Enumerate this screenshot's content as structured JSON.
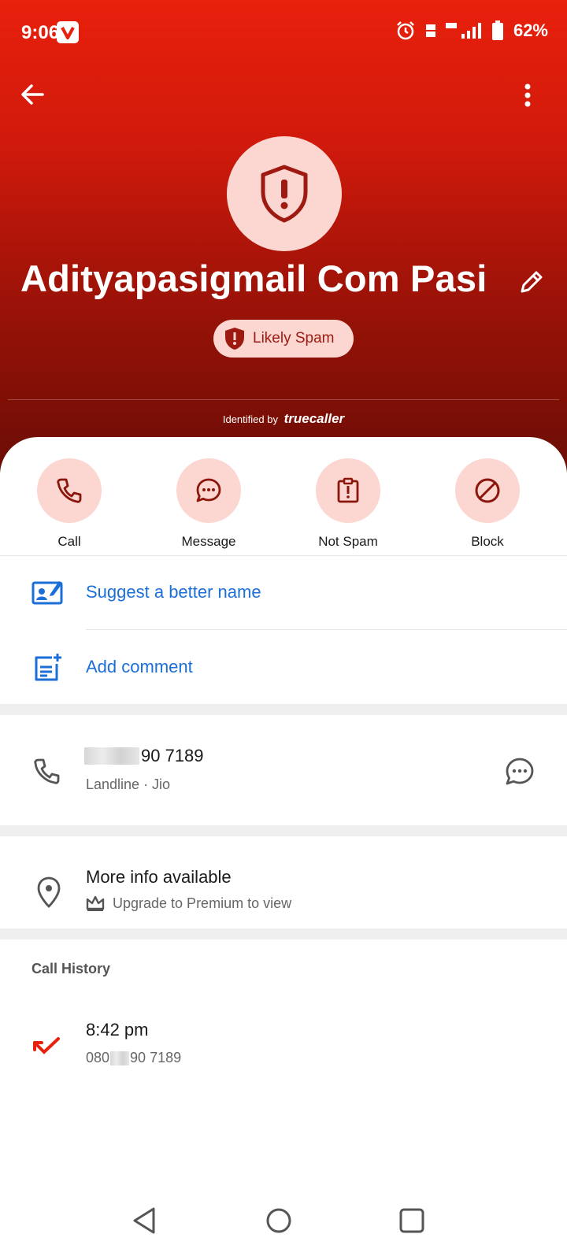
{
  "status_bar": {
    "time": "9:06",
    "battery": "62%"
  },
  "contact": {
    "name": "Adityapasigmail Com Pasi",
    "badge": "Likely Spam"
  },
  "identified": {
    "prefix": "Identified by",
    "brand": "truecaller"
  },
  "actions": [
    {
      "label": "Call",
      "icon": "phone-icon"
    },
    {
      "label": "Message",
      "icon": "chat-bubble-icon"
    },
    {
      "label": "Not Spam",
      "icon": "clipboard-alert-icon"
    },
    {
      "label": "Block",
      "icon": "block-icon"
    }
  ],
  "links": {
    "suggest_name": "Suggest a better name",
    "add_comment": "Add comment"
  },
  "phone": {
    "number_visible": "90 7189",
    "type": "Landline · Jio"
  },
  "more_info": {
    "title": "More info available",
    "subtitle": "Upgrade to Premium to view"
  },
  "call_history": {
    "heading": "Call History",
    "entries": [
      {
        "time": "8:42 pm",
        "number_prefix": "080",
        "number_suffix": "90 7189"
      }
    ]
  },
  "colors": {
    "accent_red": "#e8200c",
    "badge_bg": "#fcd6d0",
    "link_blue": "#1b6fd6"
  }
}
